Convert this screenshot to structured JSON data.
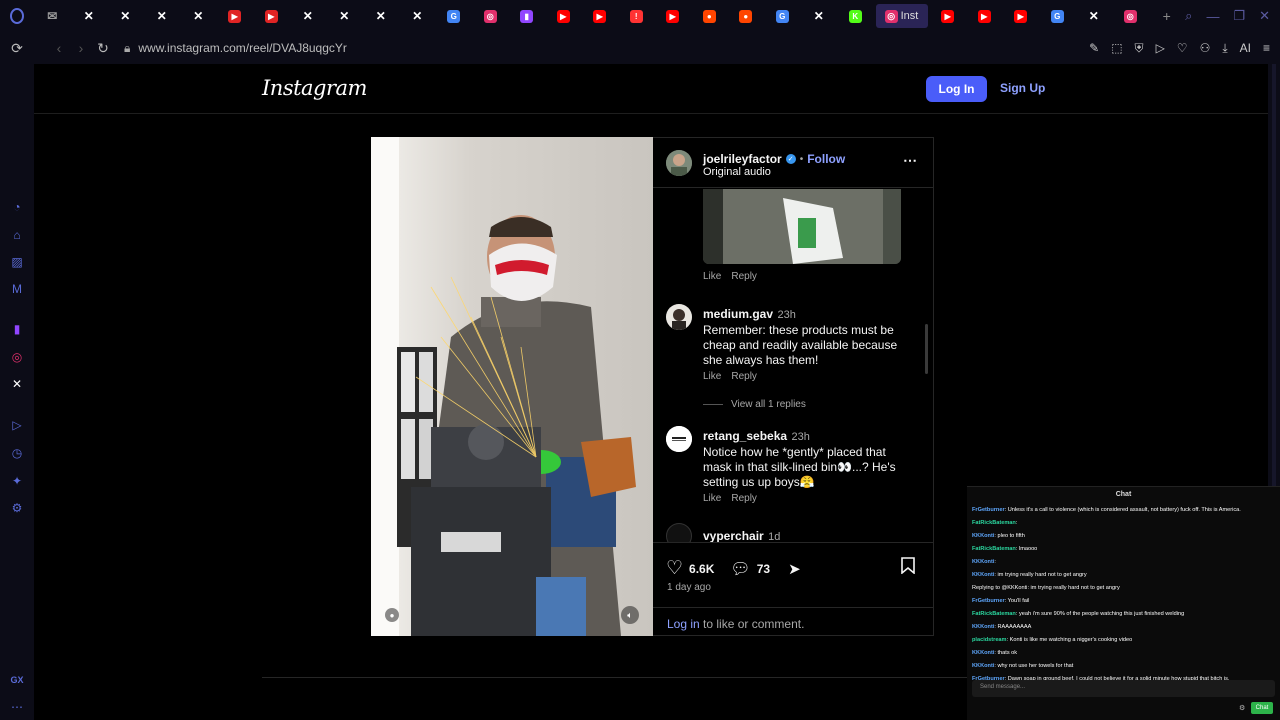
{
  "browser": {
    "tabs": [
      {
        "icon": "mail-icon",
        "color": "#999999"
      },
      {
        "icon": "x-icon",
        "color": "#ffffff"
      },
      {
        "icon": "x-icon",
        "color": "#ffffff"
      },
      {
        "icon": "x-icon",
        "color": "#ffffff"
      },
      {
        "icon": "x-icon",
        "color": "#ffffff"
      },
      {
        "icon": "play-icon",
        "color": "#e02424"
      },
      {
        "icon": "play-icon",
        "color": "#e02424"
      },
      {
        "icon": "x-icon",
        "color": "#ffffff"
      },
      {
        "icon": "x-icon",
        "color": "#ffffff"
      },
      {
        "icon": "x-icon",
        "color": "#ffffff"
      },
      {
        "icon": "x-icon",
        "color": "#ffffff"
      },
      {
        "icon": "google-icon",
        "color": "#4285f4"
      },
      {
        "icon": "instagram-icon",
        "color": "#e1306c"
      },
      {
        "icon": "twitch-icon",
        "color": "#9146ff"
      },
      {
        "icon": "youtube-icon",
        "color": "#ff0000"
      },
      {
        "icon": "youtube-icon",
        "color": "#ff0000"
      },
      {
        "icon": "alert-icon",
        "color": "#ff3333"
      },
      {
        "icon": "youtube-icon",
        "color": "#ff0000"
      },
      {
        "icon": "reddit-icon",
        "color": "#ff4500"
      },
      {
        "icon": "reddit-icon",
        "color": "#ff4500"
      },
      {
        "icon": "google-icon",
        "color": "#4285f4"
      },
      {
        "icon": "x-icon",
        "color": "#ffffff"
      },
      {
        "icon": "kick-icon",
        "color": "#53fc18"
      }
    ],
    "active_tab": {
      "icon": "instagram-icon",
      "title": "Inst"
    },
    "tabs_after": [
      {
        "icon": "youtube-icon",
        "color": "#ff0000"
      },
      {
        "icon": "youtube-icon",
        "color": "#ff0000"
      },
      {
        "icon": "youtube-icon",
        "color": "#ff0000"
      },
      {
        "icon": "google-icon",
        "color": "#4285f4"
      },
      {
        "icon": "x-icon",
        "color": "#ffffff"
      },
      {
        "icon": "instagram-icon",
        "color": "#e1306c"
      }
    ],
    "new_tab": "+",
    "url": "www.instagram.com/reel/DVAJ8uqgcYr",
    "url_right_ai": "AI",
    "sidebar_bottom": "GX"
  },
  "header": {
    "logo": "Instagram",
    "login": "Log In",
    "signup": "Sign Up"
  },
  "post": {
    "author": "joelrileyfactor",
    "follow": "Follow",
    "follow_sep": "•",
    "audio": "Original audio",
    "like_label": "Like",
    "reply_label": "Reply",
    "comments": [
      {
        "user": "medium.gav",
        "time": "23h",
        "text": "Remember: these products must be cheap and readily available because she always has them!"
      },
      {
        "user": "retang_sebeka",
        "time": "23h",
        "text": "Notice how he *gently* placed that mask in that silk-lined bin👀...? He's setting us up boys😤"
      },
      {
        "user": "vyperchair",
        "time": "1d"
      }
    ],
    "view_replies": "View all 1 replies",
    "likes": "6.6K",
    "comment_count": "73",
    "posted": "1 day ago",
    "login_link": "Log in",
    "login_rest": " to like or comment."
  },
  "chat": {
    "title": "Chat",
    "placeholder": "Send message...",
    "send": "Chat",
    "lines": [
      {
        "user": "FrGetburner",
        "text": ": Unless it's a call to violence (which is considered assault, not battery) fuck off. This is America."
      },
      {
        "user": "FatRickBateman",
        "text": ":"
      },
      {
        "user": "KKKonti",
        "text": ": pleo to fifth"
      },
      {
        "user": "FatRickBateman",
        "text": ": lmaooo"
      },
      {
        "user": "KKKonti",
        "text": ":"
      },
      {
        "user": "KKKonti",
        "text": ": im trying really hard not to get angry"
      },
      {
        "user": "Replying to @KKKonti",
        "text": ": im trying really hard not to get angry"
      },
      {
        "user": "FrGetburner",
        "text": ": You'll fail"
      },
      {
        "user": "FatRickBateman",
        "text": ": yeah i'm sure 90% of the people watching this just finished welding"
      },
      {
        "user": "KKKonti",
        "text": ": RAAAAAAAA"
      },
      {
        "user": "placidstream",
        "text": ": Konti is like me watching a nigger's cooking video"
      },
      {
        "user": "KKKonti",
        "text": ": thats ok"
      },
      {
        "user": "KKKonti",
        "text": ": why not use her towels for that"
      },
      {
        "user": "FrGetburner",
        "text": ": Dawn soap in ground beef. I could not believe it for a solid minute how stupid that bitch is."
      }
    ]
  }
}
